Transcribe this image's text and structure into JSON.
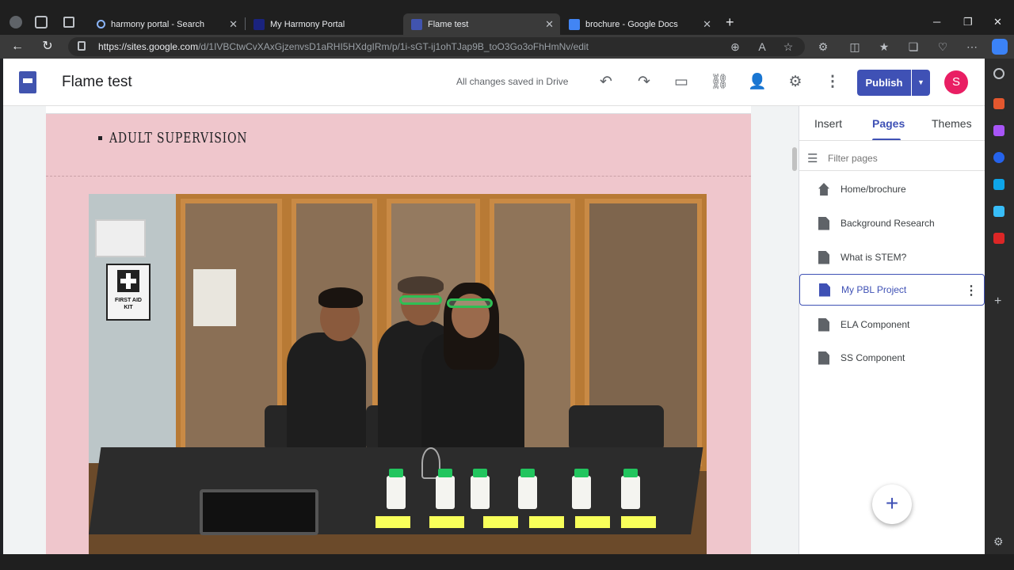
{
  "browser": {
    "tabs": [
      {
        "label": "harmony portal - Search",
        "icon": "search-icon"
      },
      {
        "label": "My Harmony Portal",
        "icon": "portal-icon"
      },
      {
        "label": "Flame test",
        "icon": "google-sites-icon",
        "active": true
      },
      {
        "label": "brochure - Google Docs",
        "icon": "google-docs-icon"
      }
    ],
    "url_host": "https://sites.google.com",
    "url_path": "/d/1IVBCtwCvXAxGjzenvsD1aRHI5HXdgIRm/p/1i-sGT-ij1ohTJap9B_toO3Go3oFhHmNv/edit"
  },
  "app": {
    "title": "Flame test",
    "save_status": "All changes saved in Drive",
    "publish_label": "Publish",
    "avatar_letter": "S",
    "accent_color": "#3f51b5"
  },
  "content": {
    "bullet_text": "ADULT SUPERVISION",
    "page_bg_color": "#efc6cc"
  },
  "panel": {
    "tabs": {
      "insert": "Insert",
      "pages": "Pages",
      "themes": "Themes"
    },
    "active_tab": "Pages",
    "filter_placeholder": "Filter pages",
    "pages": [
      {
        "label": "Home/brochure",
        "icon": "home-icon"
      },
      {
        "label": "Background Research",
        "icon": "page-icon"
      },
      {
        "label": "What is STEM?",
        "icon": "page-icon"
      },
      {
        "label": "My PBL Project",
        "icon": "page-icon",
        "selected": true
      },
      {
        "label": "ELA Component",
        "icon": "page-icon"
      },
      {
        "label": "SS Component",
        "icon": "page-icon"
      }
    ]
  }
}
